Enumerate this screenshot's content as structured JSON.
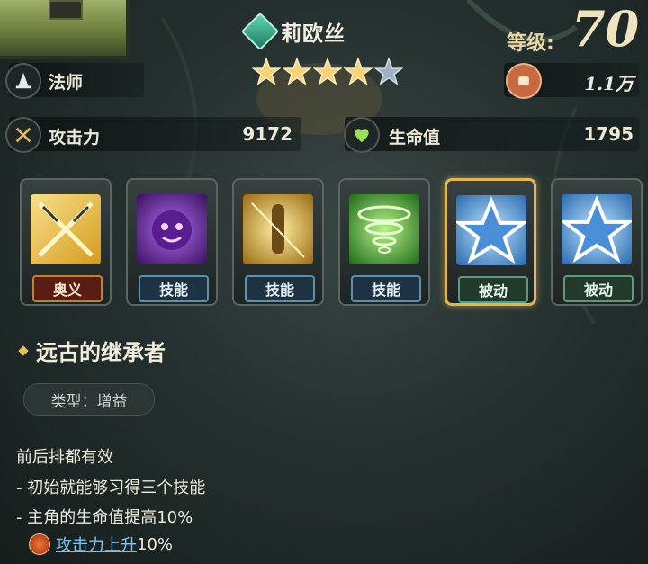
{
  "header": {
    "character_name": "莉欧丝",
    "element_icon": "wind-element-icon",
    "stars_filled": 4,
    "stars_total": 5,
    "level_label": "等级:",
    "level_value": "70"
  },
  "stats": {
    "class_label": "法师",
    "class_icon": "mage-hat-icon",
    "power_value": "1.1万",
    "power_icon": "fist-icon",
    "attack_label": "攻击力",
    "attack_value": "9172",
    "attack_icon": "crossed-swords-icon",
    "hp_label": "生命值",
    "hp_value": "1795",
    "hp_icon": "heart-icon"
  },
  "skills": [
    {
      "tag": "奥义",
      "style": "red",
      "icon": "crossed-swords-skill-icon"
    },
    {
      "tag": "技能",
      "style": "blue",
      "icon": "purple-spirit-skill-icon"
    },
    {
      "tag": "技能",
      "style": "blue",
      "icon": "golden-warrior-skill-icon"
    },
    {
      "tag": "技能",
      "style": "blue",
      "icon": "green-tornado-skill-icon"
    },
    {
      "tag": "被动",
      "style": "green",
      "icon": "blue-star-skill-icon",
      "selected": true
    },
    {
      "tag": "被动",
      "style": "green",
      "icon": "blue-star-skill-icon"
    }
  ],
  "detail": {
    "title": "远古的继承者",
    "type_text": "类型：增益",
    "lines": [
      "前后排都有效",
      "- 初始就能够习得三个技能",
      "- 主角的生命值提高10%"
    ],
    "buff_link": "攻击力上升",
    "buff_suffix": "10%"
  },
  "colors": {
    "accent_gold": "#e0b656",
    "link_blue": "#7fc2ea",
    "tag_red": "#5a1d16",
    "tag_blue": "#1d3344",
    "tag_green": "#213a2c"
  }
}
